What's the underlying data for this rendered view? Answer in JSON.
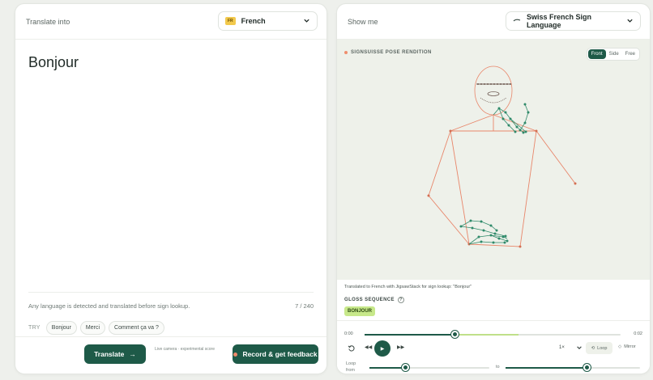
{
  "left_panel": {
    "label": "Translate into",
    "language": {
      "code": "FR",
      "name": "French"
    },
    "source_text": "Bonjour",
    "hint": "Any language is detected and translated before sign lookup.",
    "char_count": "7 / 240",
    "try_label": "TRY",
    "suggestions": [
      "Bonjour",
      "Merci",
      "Comment ça va ?"
    ],
    "translate_button": "Translate",
    "camera_note": "Live camera · experimental score",
    "record_button": "Record & get feedback"
  },
  "right_panel": {
    "label": "Show me",
    "sign_language": "Swiss French Sign Language",
    "stage_title": "SIGNSUISSE POSE RENDITION",
    "views": [
      "Front",
      "Side",
      "Free"
    ],
    "active_view": "Front",
    "translation_note": "Translated to French with JigsawStack for sign lookup: \"Bonjour\"",
    "gloss_heading": "GLOSS SEQUENCE",
    "gloss_help": "?",
    "gloss_tokens": [
      "BONJOUR"
    ],
    "player": {
      "time_current": "0:00",
      "time_total": "0:02",
      "progress": 0.35,
      "buffered": 0.6,
      "speed": "1×",
      "loop_label": "Loop",
      "mirror_label": "Mirror",
      "loop_from_label": "Loop from",
      "to_label": "to",
      "loop_from_value": 0.3,
      "loop_to_value": 0.6
    }
  },
  "colors": {
    "accent": "#1e5a48",
    "body_lines": "#e8866a",
    "hand_lines": "#2f8a6a",
    "gloss_bg": "#c7e88a",
    "stage_bg": "#eef1ea"
  },
  "icons": [
    "chevron-down-icon",
    "arrow-right-icon",
    "record-dot-icon",
    "sign-language-icon",
    "replay-icon",
    "skip-back-icon",
    "play-icon",
    "skip-forward-icon",
    "loop-icon",
    "mirror-icon"
  ]
}
